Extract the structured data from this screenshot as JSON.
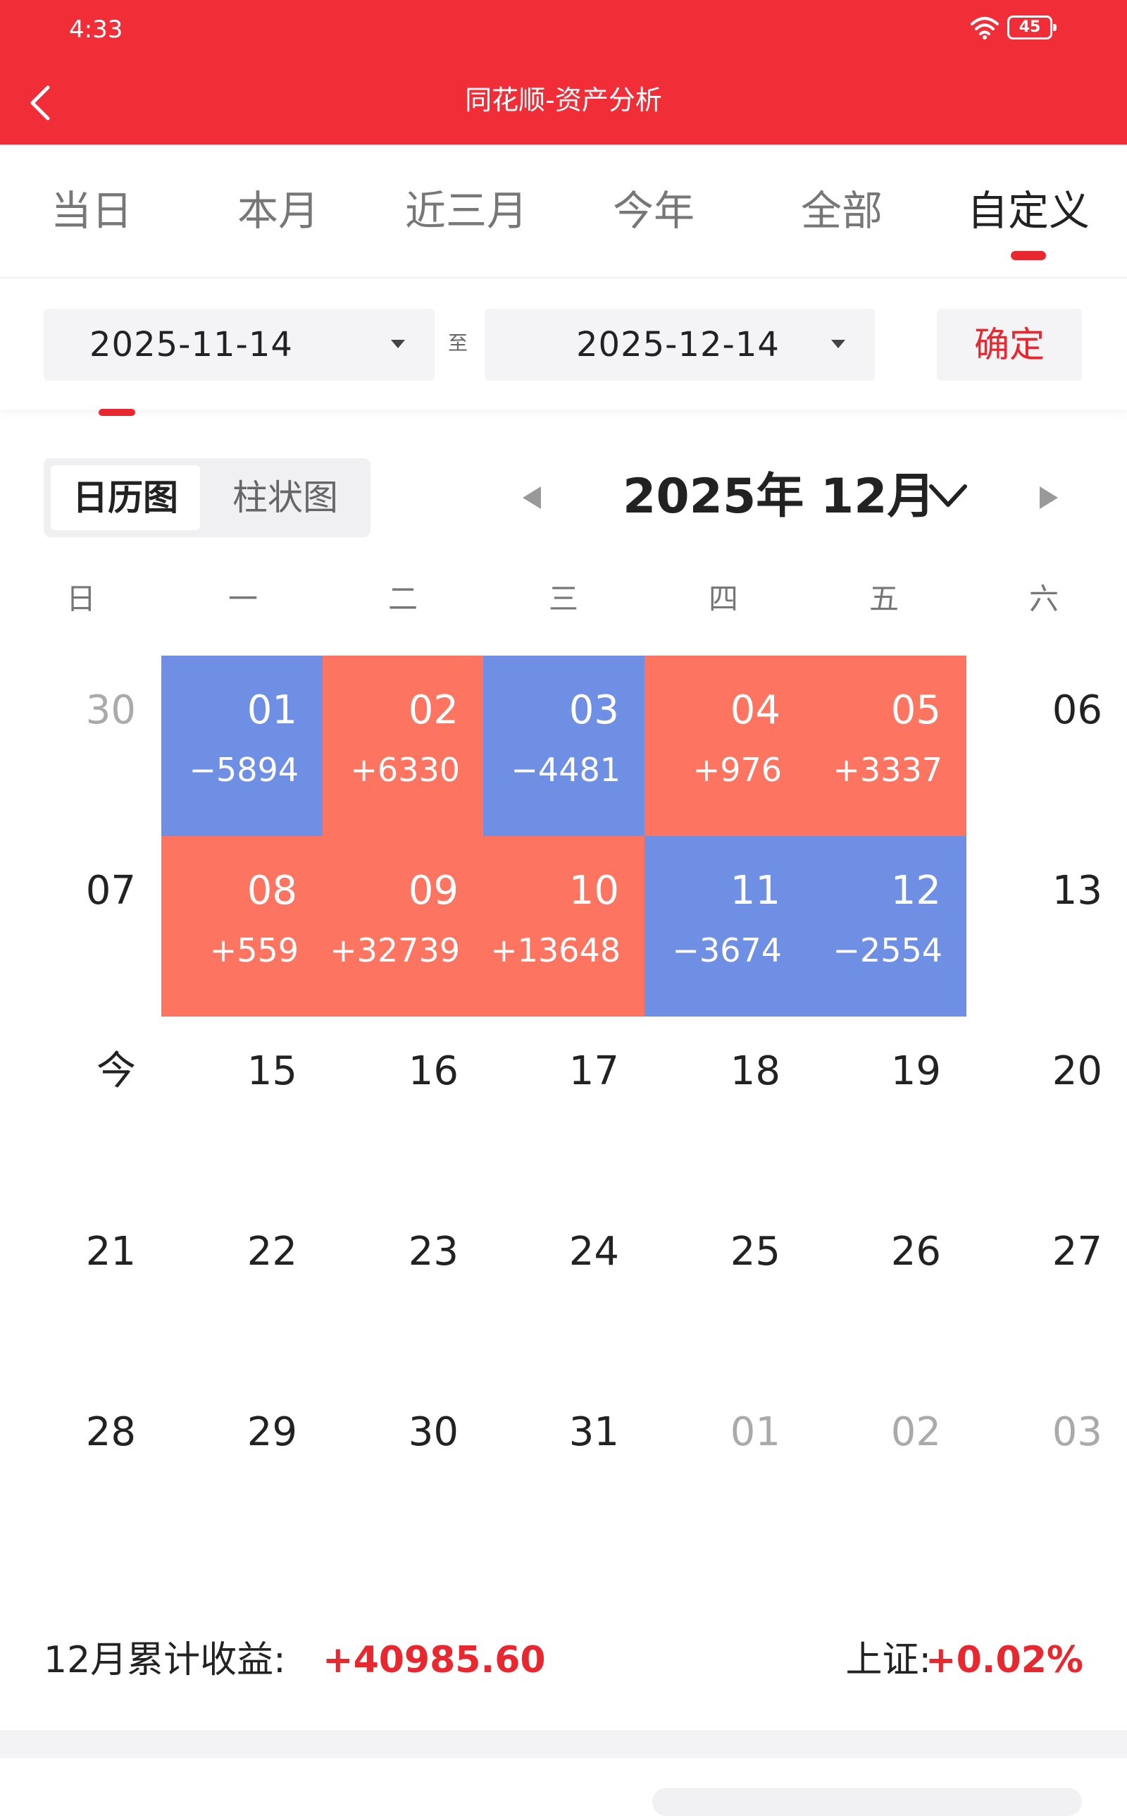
{
  "status_bar": {
    "time": "4:33",
    "battery": "45"
  },
  "header": {
    "title": "同花顺-资产分析"
  },
  "tabs": [
    {
      "label": "当日",
      "active": false
    },
    {
      "label": "本月",
      "active": false
    },
    {
      "label": "近三月",
      "active": false
    },
    {
      "label": "今年",
      "active": false
    },
    {
      "label": "全部",
      "active": false
    },
    {
      "label": "自定义",
      "active": true
    }
  ],
  "range": {
    "start": "2025-11-14",
    "to_label": "至",
    "end": "2025-12-14",
    "confirm_label": "确定"
  },
  "view_toggle": {
    "calendar_label": "日历图",
    "bar_label": "柱状图",
    "selected": "日历图"
  },
  "month_nav": {
    "title": "2025年 12月"
  },
  "weekdays": [
    "日",
    "一",
    "二",
    "三",
    "四",
    "五",
    "六"
  ],
  "calendar": {
    "weeks": [
      [
        {
          "day": "30",
          "value": "",
          "kind": "muted"
        },
        {
          "day": "01",
          "value": "−5894",
          "kind": "down"
        },
        {
          "day": "02",
          "value": "+6330",
          "kind": "up"
        },
        {
          "day": "03",
          "value": "−4481",
          "kind": "down"
        },
        {
          "day": "04",
          "value": "+976",
          "kind": "up"
        },
        {
          "day": "05",
          "value": "+3337",
          "kind": "up"
        },
        {
          "day": "06",
          "value": "",
          "kind": "normal"
        }
      ],
      [
        {
          "day": "07",
          "value": "",
          "kind": "normal"
        },
        {
          "day": "08",
          "value": "+559",
          "kind": "up"
        },
        {
          "day": "09",
          "value": "+32739",
          "kind": "up"
        },
        {
          "day": "10",
          "value": "+13648",
          "kind": "up"
        },
        {
          "day": "11",
          "value": "−3674",
          "kind": "down"
        },
        {
          "day": "12",
          "value": "−2554",
          "kind": "down"
        },
        {
          "day": "13",
          "value": "",
          "kind": "normal"
        }
      ],
      [
        {
          "day": "今",
          "value": "",
          "kind": "normal"
        },
        {
          "day": "15",
          "value": "",
          "kind": "normal"
        },
        {
          "day": "16",
          "value": "",
          "kind": "normal"
        },
        {
          "day": "17",
          "value": "",
          "kind": "normal"
        },
        {
          "day": "18",
          "value": "",
          "kind": "normal"
        },
        {
          "day": "19",
          "value": "",
          "kind": "normal"
        },
        {
          "day": "20",
          "value": "",
          "kind": "normal"
        }
      ],
      [
        {
          "day": "21",
          "value": "",
          "kind": "normal"
        },
        {
          "day": "22",
          "value": "",
          "kind": "normal"
        },
        {
          "day": "23",
          "value": "",
          "kind": "normal"
        },
        {
          "day": "24",
          "value": "",
          "kind": "normal"
        },
        {
          "day": "25",
          "value": "",
          "kind": "normal"
        },
        {
          "day": "26",
          "value": "",
          "kind": "normal"
        },
        {
          "day": "27",
          "value": "",
          "kind": "normal"
        }
      ],
      [
        {
          "day": "28",
          "value": "",
          "kind": "normal"
        },
        {
          "day": "29",
          "value": "",
          "kind": "normal"
        },
        {
          "day": "30",
          "value": "",
          "kind": "normal"
        },
        {
          "day": "31",
          "value": "",
          "kind": "normal"
        },
        {
          "day": "01",
          "value": "",
          "kind": "muted"
        },
        {
          "day": "02",
          "value": "",
          "kind": "muted"
        },
        {
          "day": "03",
          "value": "",
          "kind": "muted"
        }
      ]
    ]
  },
  "summary": {
    "label": "12月累计收益:",
    "value": "+40985.60",
    "index_label": "上证:",
    "index_value": "+0.02%"
  },
  "colors": {
    "brand_red": "#f12d37",
    "gain": "#fd7460",
    "loss": "#6e8fe4",
    "accent_text": "#e8272f"
  },
  "icons": {
    "back": "chevron-left-icon",
    "wifi": "wifi-icon",
    "prev_month": "triangle-left-icon",
    "next_month": "triangle-right-icon",
    "month_picker": "chevron-down-icon",
    "date_dropdown": "caret-down-icon"
  }
}
